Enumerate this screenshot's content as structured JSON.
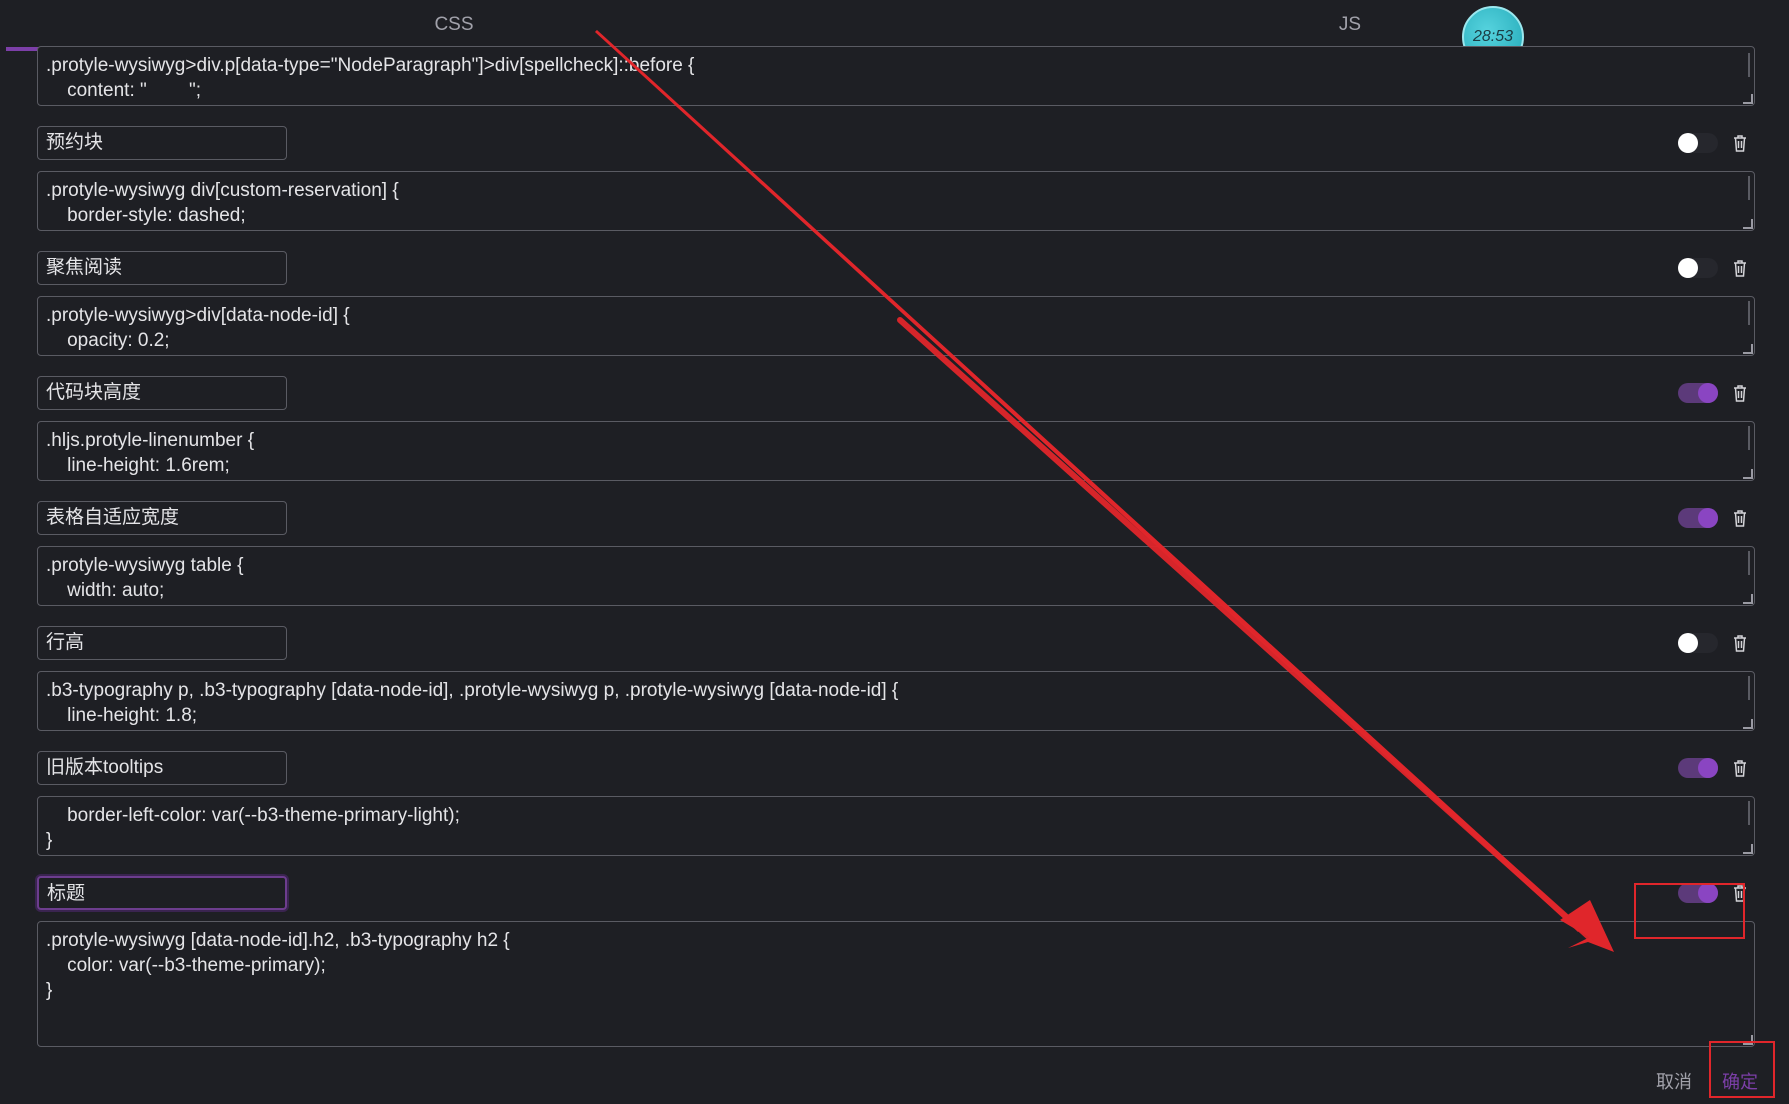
{
  "tabs": [
    {
      "label": "CSS",
      "active": true
    },
    {
      "label": "JS",
      "active": false
    }
  ],
  "timer": {
    "label": "28:53"
  },
  "accent_color": "#7c3fa8",
  "snippets": [
    {
      "name": "",
      "code": [
        ".protyle-wysiwyg>div.p[data-type=\"NodeParagraph\"]>div[spellcheck]::before {",
        "    content: \"        \";"
      ],
      "enabled": null
    },
    {
      "name": "预约块",
      "code": [
        ".protyle-wysiwyg div[custom-reservation] {",
        "    border-style: dashed;"
      ],
      "enabled": false
    },
    {
      "name": "聚焦阅读",
      "code": [
        ".protyle-wysiwyg>div[data-node-id] {",
        "    opacity: 0.2;"
      ],
      "enabled": false
    },
    {
      "name": "代码块高度",
      "code": [
        ".hljs.protyle-linenumber {",
        "    line-height: 1.6rem;"
      ],
      "enabled": true
    },
    {
      "name": "表格自适应宽度",
      "code": [
        ".protyle-wysiwyg table {",
        "    width: auto;"
      ],
      "enabled": true
    },
    {
      "name": "行高",
      "code": [
        ".b3-typography p, .b3-typography [data-node-id], .protyle-wysiwyg p, .protyle-wysiwyg [data-node-id] {",
        "    line-height: 1.8;"
      ],
      "enabled": false
    },
    {
      "name": "旧版本tooltips",
      "code": [
        "    border-left-color: var(--b3-theme-primary-light);",
        "}"
      ],
      "enabled": true
    },
    {
      "name": "标题",
      "code": [
        ".protyle-wysiwyg [data-node-id].h2, .b3-typography h2 {",
        "    color: var(--b3-theme-primary);",
        "}"
      ],
      "enabled": true
    }
  ],
  "footer": {
    "cancel_label": "取消",
    "confirm_label": "确定"
  },
  "annotation_color": "#e0262b"
}
